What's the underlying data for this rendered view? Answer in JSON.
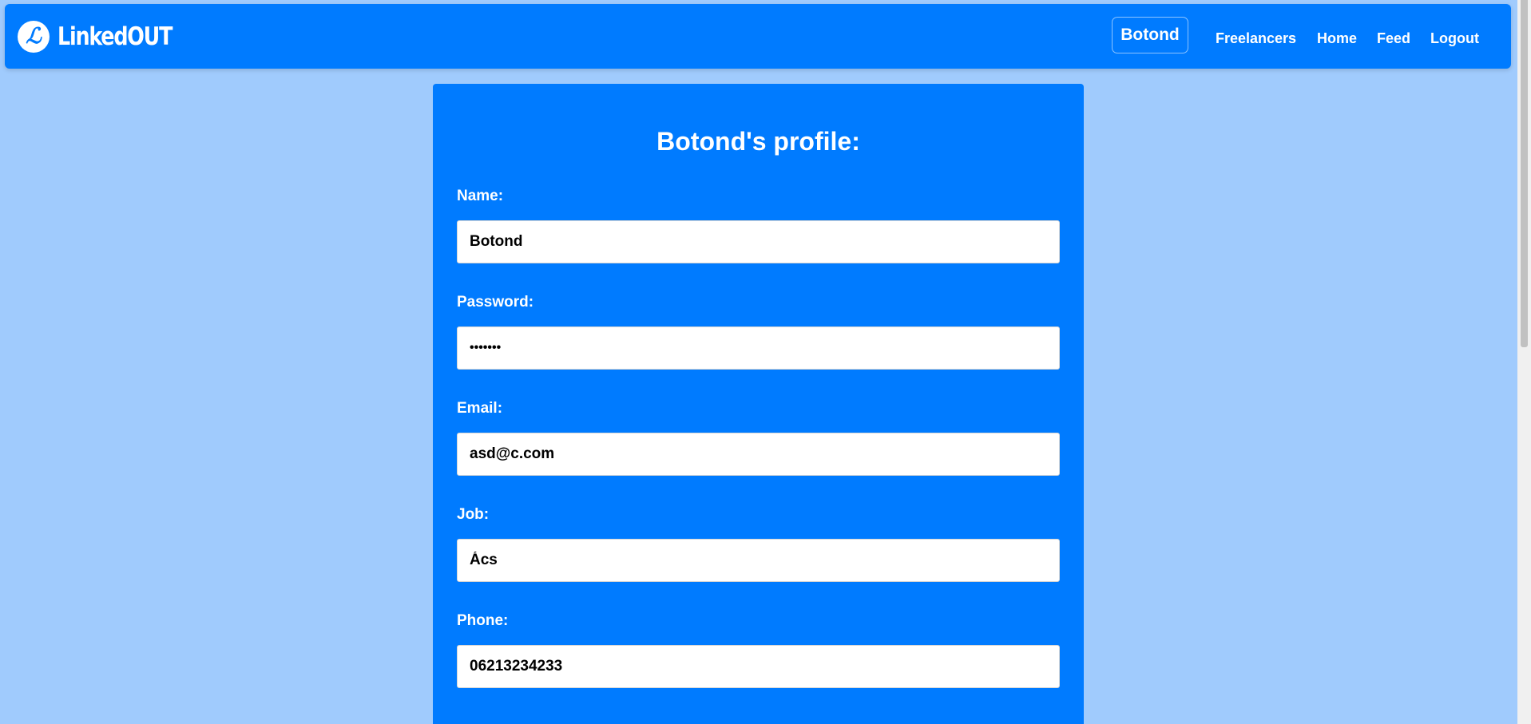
{
  "navbar": {
    "brand_logo_glyph": "ℒ",
    "brand_name": "LinkedOUT",
    "current_user": "Botond",
    "links": [
      "Freelancers",
      "Home",
      "Feed",
      "Logout"
    ],
    "background_color": "#007bff"
  },
  "page": {
    "background_color": "#a0cbfd"
  },
  "profile": {
    "title": "Botond's profile:",
    "fields": {
      "name": {
        "label": "Name:",
        "value": "Botond"
      },
      "password": {
        "label": "Password:",
        "value": "•••••••"
      },
      "email": {
        "label": "Email:",
        "value": "asd@c.com"
      },
      "job": {
        "label": "Job:",
        "value": "Ács"
      },
      "phone": {
        "label": "Phone:",
        "value": "06213234233"
      }
    }
  }
}
